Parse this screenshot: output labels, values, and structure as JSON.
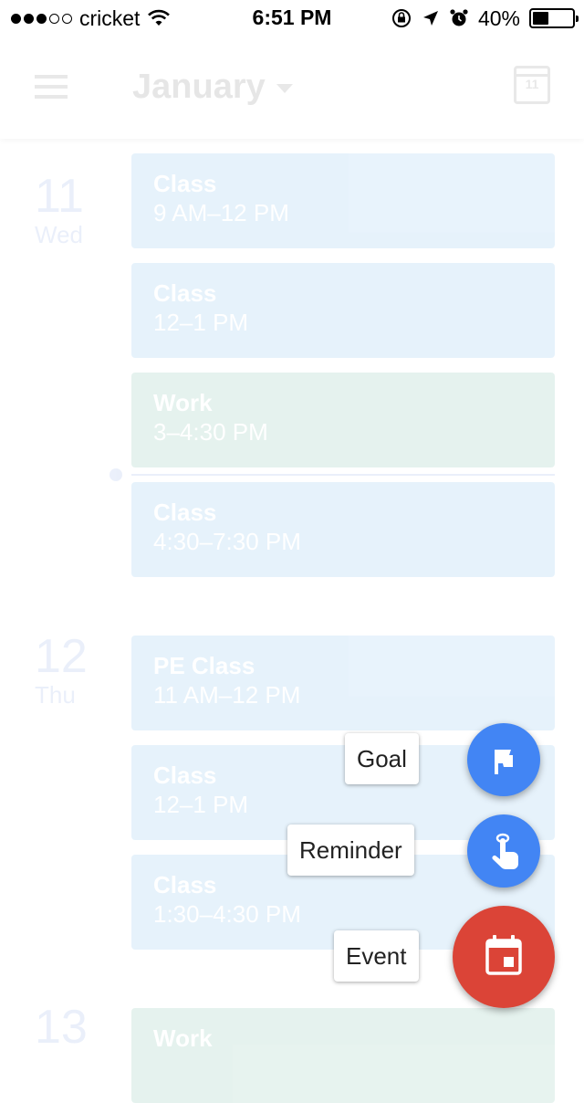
{
  "status_bar": {
    "carrier": "cricket",
    "time": "6:51 PM",
    "battery": "40%",
    "battery_level": 0.4
  },
  "app_bar": {
    "month": "January",
    "calendar_day": "11"
  },
  "days": [
    {
      "num": "11",
      "name": "Wed",
      "events": [
        {
          "title": "Class",
          "time": "9 AM–12 PM",
          "color": "blue"
        },
        {
          "title": "Class",
          "time": "12–1 PM",
          "color": "blue"
        },
        {
          "title": "Work",
          "time": "3–4:30 PM",
          "color": "green"
        },
        {
          "title": "Class",
          "time": "4:30–7:30 PM",
          "color": "blue"
        }
      ]
    },
    {
      "num": "12",
      "name": "Thu",
      "events": [
        {
          "title": "PE Class",
          "time": "11 AM–12 PM",
          "color": "blue"
        },
        {
          "title": "Class",
          "time": "12–1 PM",
          "color": "blue"
        },
        {
          "title": "Class",
          "time": "1:30–4:30 PM",
          "color": "blue"
        }
      ]
    },
    {
      "num": "13",
      "name": "",
      "events": [
        {
          "title": "Work",
          "time": "",
          "color": "green"
        }
      ]
    }
  ],
  "fab_menu": {
    "goal_label": "Goal",
    "reminder_label": "Reminder",
    "event_label": "Event"
  },
  "colors": {
    "accent_blue": "#4285f4",
    "fab_red": "#db4437",
    "event_blue": "#1a8be0",
    "event_green": "#0f8a5f"
  },
  "icons": [
    "menu-icon",
    "dropdown-arrow-icon",
    "calendar-today-icon",
    "flag-icon",
    "reminder-finger-icon",
    "calendar-event-icon",
    "wifi-icon",
    "orientation-lock-icon",
    "location-arrow-icon",
    "alarm-icon",
    "battery-icon"
  ]
}
